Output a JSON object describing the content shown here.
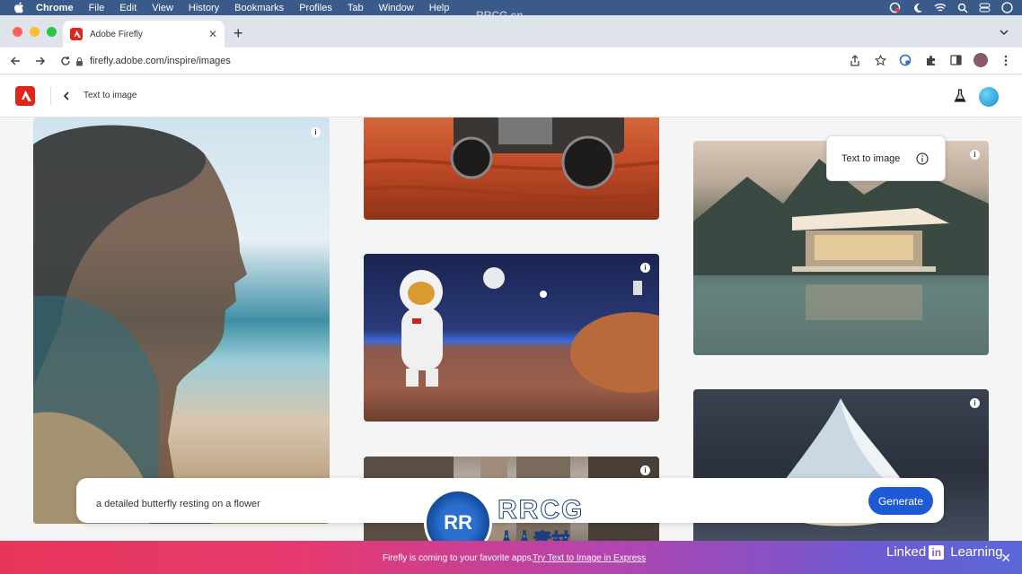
{
  "menubar": {
    "items": [
      "Chrome",
      "File",
      "Edit",
      "View",
      "History",
      "Bookmarks",
      "Profiles",
      "Tab",
      "Window",
      "Help"
    ]
  },
  "browser": {
    "tab_title": "Adobe Firefly",
    "url": "firefly.adobe.com/inspire/images"
  },
  "header": {
    "breadcrumb": "Text to image"
  },
  "tooltip": {
    "label": "Text to image"
  },
  "prompt": {
    "text": "a detailed butterfly resting on a flower",
    "generate_label": "Generate"
  },
  "banner": {
    "message": "Firefly is coming to your favorite apps.",
    "link": "Try Text to Image in Express"
  },
  "branding": {
    "linkedin_word1": "Linked",
    "linkedin_in": "in",
    "linkedin_word2": "Learning",
    "watermark_top": "RRCG.cn",
    "watermark_logo": "RRCG",
    "watermark_sub": "人人素材",
    "watermark_circle": "RR"
  },
  "colors": {
    "adobe_red": "#e1251b",
    "generate_blue": "#1f5ad6",
    "menubar": "#3a5a8a"
  }
}
